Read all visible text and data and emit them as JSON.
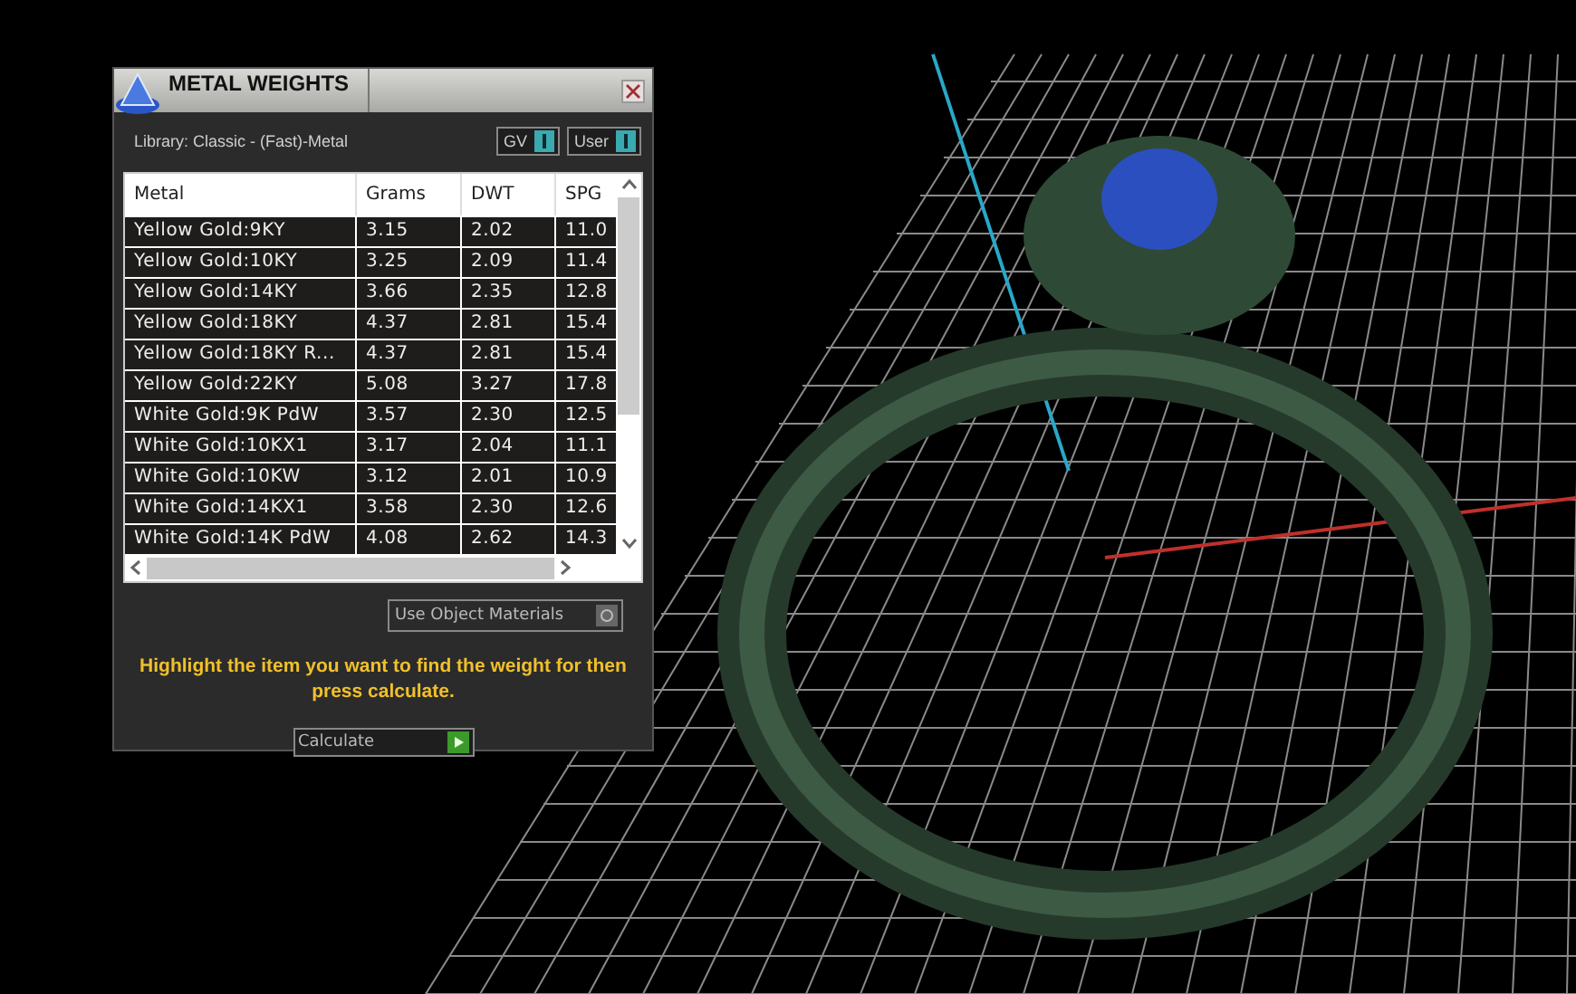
{
  "window": {
    "title": "METAL WEIGHTS"
  },
  "library": {
    "label": "Library: Classic - (Fast)-Metal"
  },
  "toggles": [
    {
      "label": "GV"
    },
    {
      "label": "User"
    }
  ],
  "table": {
    "columns": [
      "Metal",
      "Grams",
      "DWT",
      "SPG"
    ],
    "rows": [
      [
        "Yellow Gold:9KY",
        "3.15",
        "2.02",
        "11.0"
      ],
      [
        "Yellow Gold:10KY",
        "3.25",
        "2.09",
        "11.4"
      ],
      [
        "Yellow Gold:14KY",
        "3.66",
        "2.35",
        "12.8"
      ],
      [
        "Yellow Gold:18KY",
        "4.37",
        "2.81",
        "15.4"
      ],
      [
        "Yellow Gold:18KY R...",
        "4.37",
        "2.81",
        "15.4"
      ],
      [
        "Yellow Gold:22KY",
        "5.08",
        "3.27",
        "17.8"
      ],
      [
        "White Gold:9K PdW",
        "3.57",
        "2.30",
        "12.5"
      ],
      [
        "White Gold:10KX1",
        "3.17",
        "2.04",
        "11.1"
      ],
      [
        "White Gold:10KW",
        "3.12",
        "2.01",
        "10.9"
      ],
      [
        "White Gold:14KX1",
        "3.58",
        "2.30",
        "12.6"
      ],
      [
        "White Gold:14K PdW",
        "4.08",
        "2.62",
        "14.3"
      ]
    ]
  },
  "materials_button": {
    "label": "Use Object Materials"
  },
  "instruction": "Highlight the item you want to find the weight for then press calculate.",
  "calculate_button": {
    "label": "Calculate"
  }
}
